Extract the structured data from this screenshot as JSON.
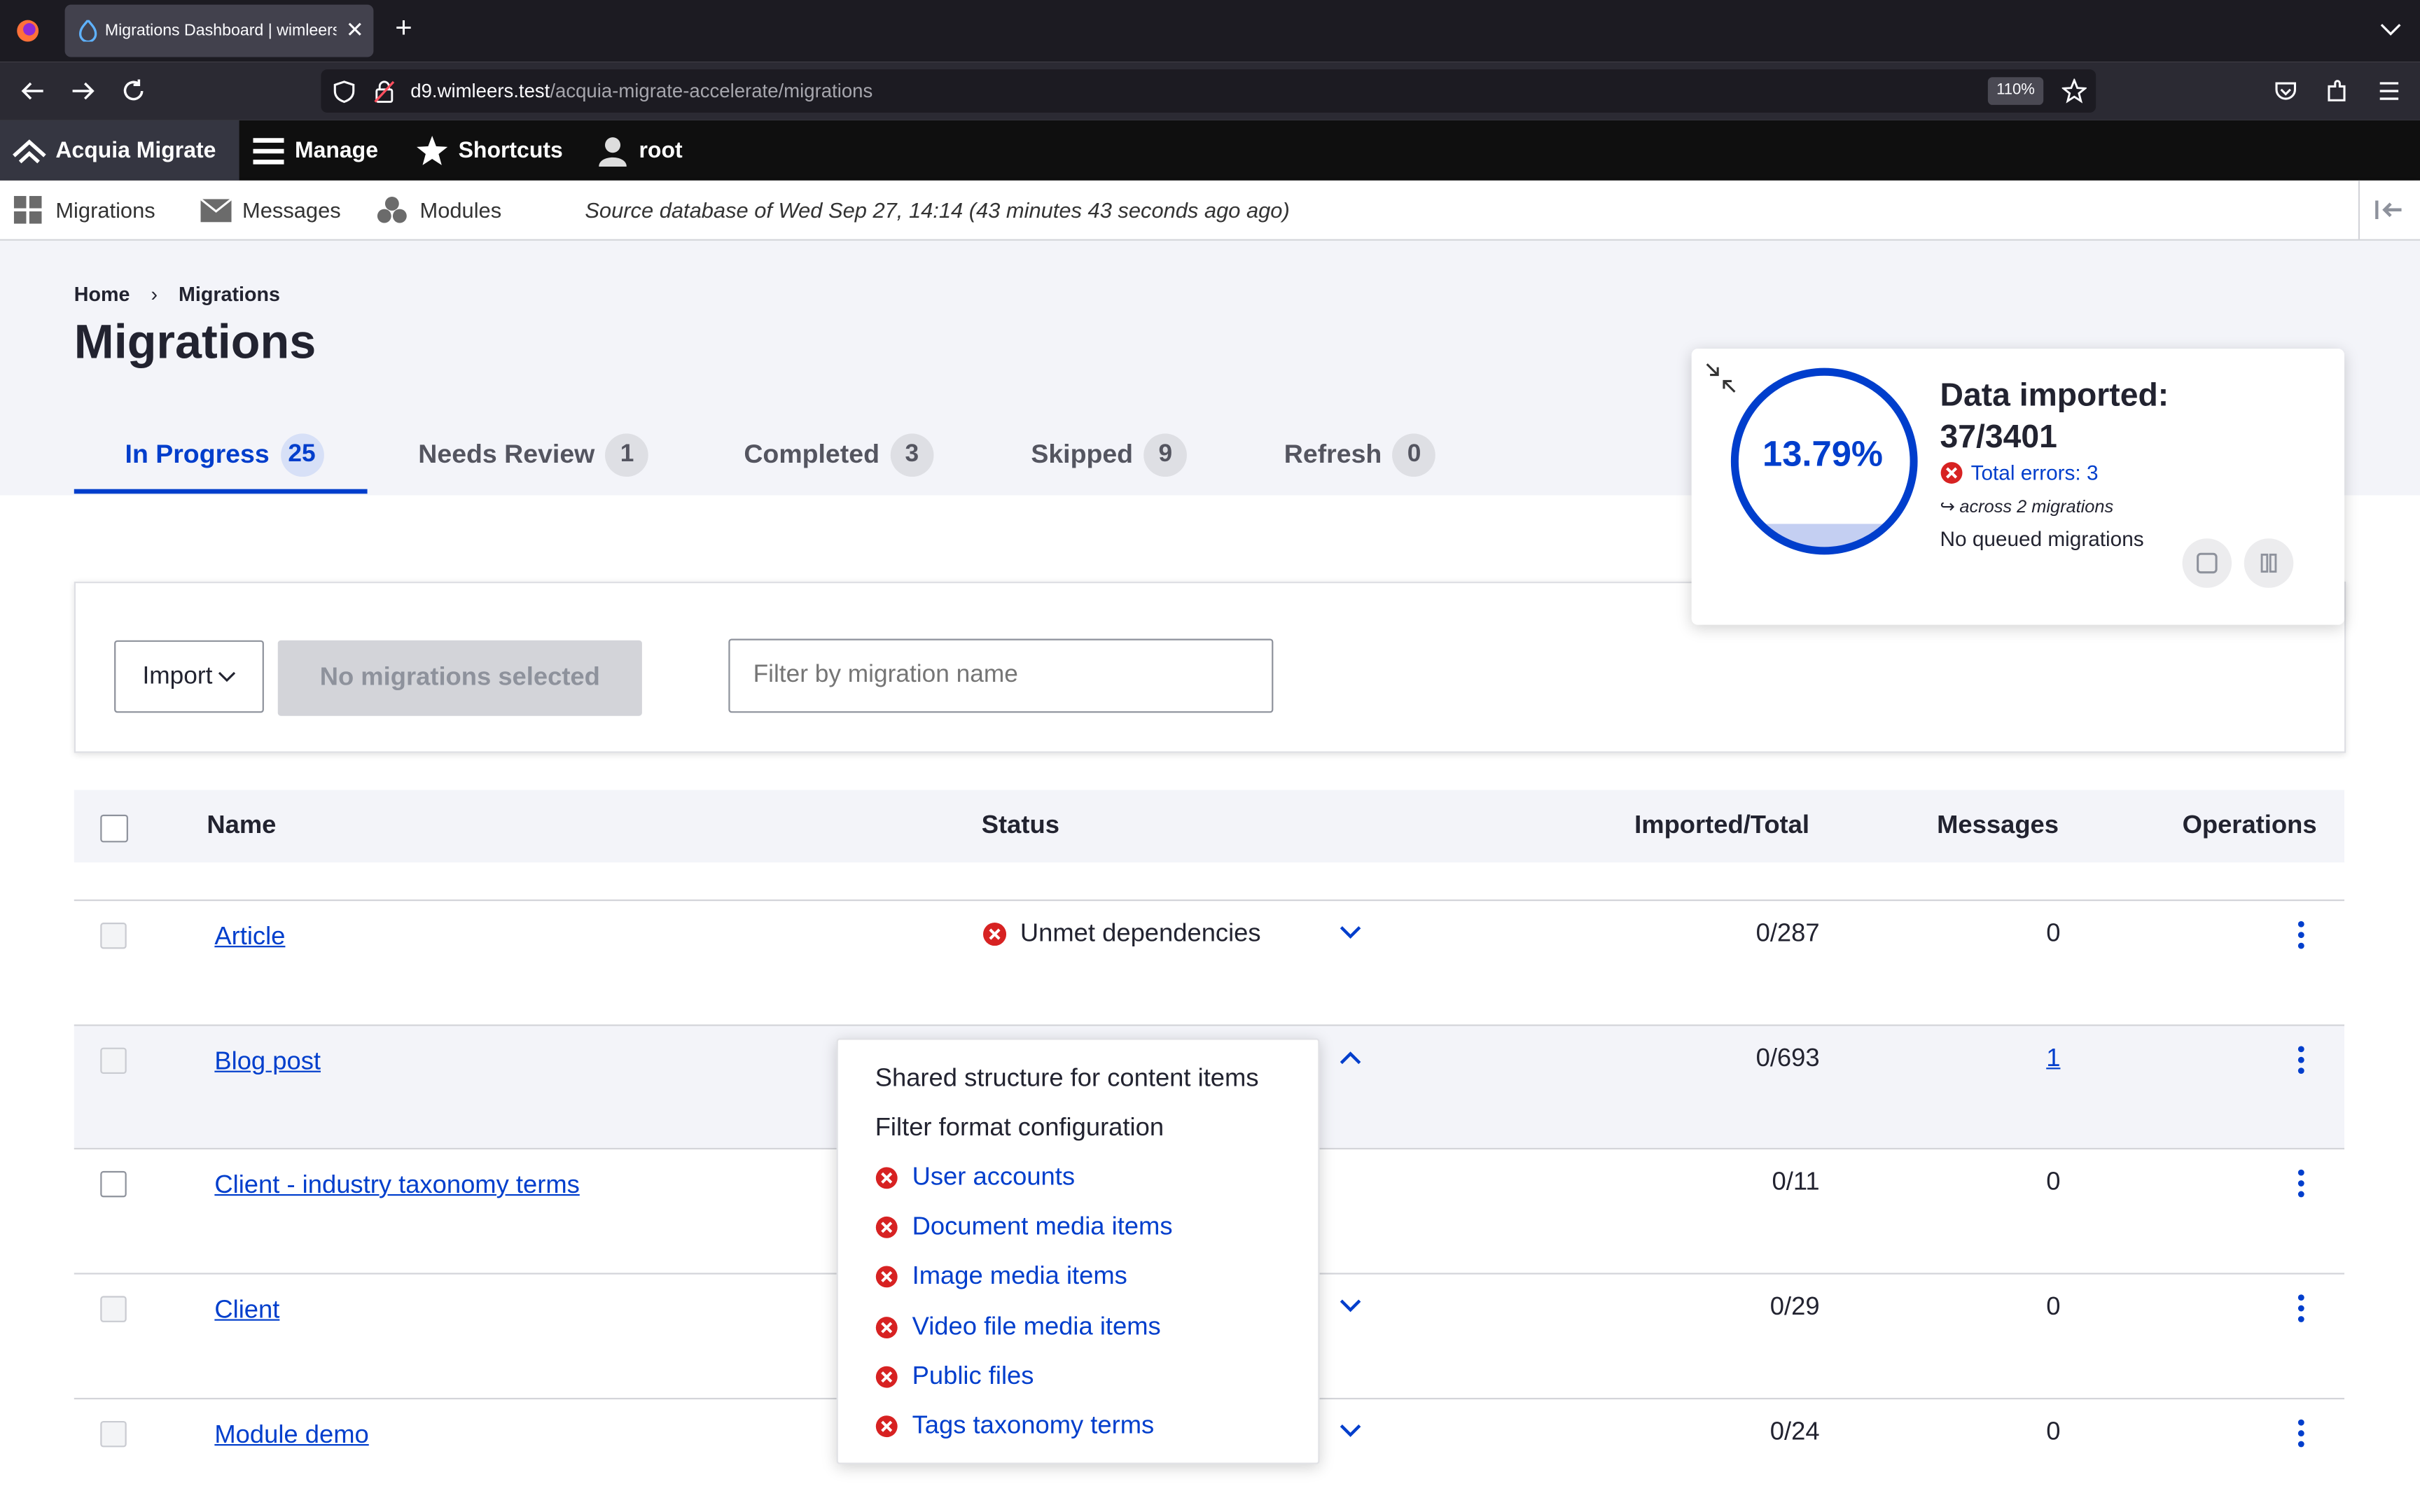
{
  "browser": {
    "tab_title": "Migrations Dashboard | wimleers",
    "url_host": "d9.wimleers.test",
    "url_path": "/acquia-migrate-accelerate/migrations",
    "zoom": "110%"
  },
  "toolbar": {
    "brand": "Acquia Migrate",
    "manage": "Manage",
    "shortcuts": "Shortcuts",
    "user": "root"
  },
  "tray": {
    "migrations": "Migrations",
    "messages": "Messages",
    "modules": "Modules",
    "source_info": "Source database of Wed Sep 27, 14:14 (43 minutes 43 seconds ago ago)"
  },
  "breadcrumb": {
    "home": "Home",
    "current": "Migrations"
  },
  "page_title": "Migrations",
  "tabs": [
    {
      "label": "In Progress",
      "count": "25"
    },
    {
      "label": "Needs Review",
      "count": "1"
    },
    {
      "label": "Completed",
      "count": "3"
    },
    {
      "label": "Skipped",
      "count": "9"
    },
    {
      "label": "Refresh",
      "count": "0"
    }
  ],
  "controls": {
    "import_label": "Import",
    "no_selection": "No migrations selected",
    "filter_placeholder": "Filter by migration name"
  },
  "table": {
    "headers": {
      "name": "Name",
      "status": "Status",
      "imported": "Imported/Total",
      "messages": "Messages",
      "operations": "Operations"
    },
    "rows": [
      {
        "name": "Article",
        "status": "Unmet dependencies",
        "imported": "0/287",
        "messages": "0"
      },
      {
        "name": "Blog post",
        "status": "",
        "imported": "0/693",
        "messages": "1"
      },
      {
        "name": "Client - industry taxonomy terms",
        "status": "",
        "imported": "0/11",
        "messages": "0"
      },
      {
        "name": "Client",
        "status": "",
        "imported": "0/29",
        "messages": "0"
      },
      {
        "name": "Module demo",
        "status": "",
        "imported": "0/24",
        "messages": "0"
      }
    ]
  },
  "dependencies_popup": {
    "met": [
      "Shared structure for content items",
      "Filter format configuration"
    ],
    "unmet": [
      "User accounts",
      "Document media items",
      "Image media items",
      "Video file media items",
      "Public files",
      "Tags taxonomy terms"
    ]
  },
  "progress": {
    "percent_label": "13.79%",
    "percent_value": 13.79,
    "title": "Data imported:",
    "count": "37/3401",
    "errors": "Total errors: 3",
    "across": "across 2 migrations",
    "queue": "No queued migrations",
    "accent_color": "#003ecc",
    "error_color": "#d72222"
  }
}
